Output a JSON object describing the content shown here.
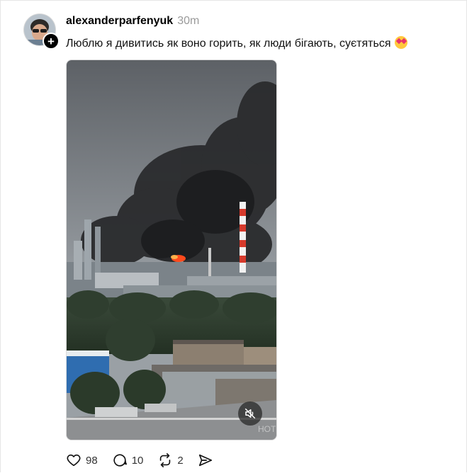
{
  "post": {
    "username": "alexanderparfenyuk",
    "time": "30m",
    "text": "Люблю я дивитись як воно горить, як люди бігають, суєтяться",
    "emoji": "heart-eyes-face-emoji",
    "follow_symbol": "+"
  },
  "media": {
    "type": "video",
    "muted": true,
    "watermark": "НОТ"
  },
  "actions": {
    "likes": "98",
    "comments": "10",
    "reposts": "2"
  },
  "colors": {
    "text": "#000000",
    "muted_text": "#9a9a9a",
    "border": "#e5e5e5",
    "fire": "#ff4a1c"
  }
}
